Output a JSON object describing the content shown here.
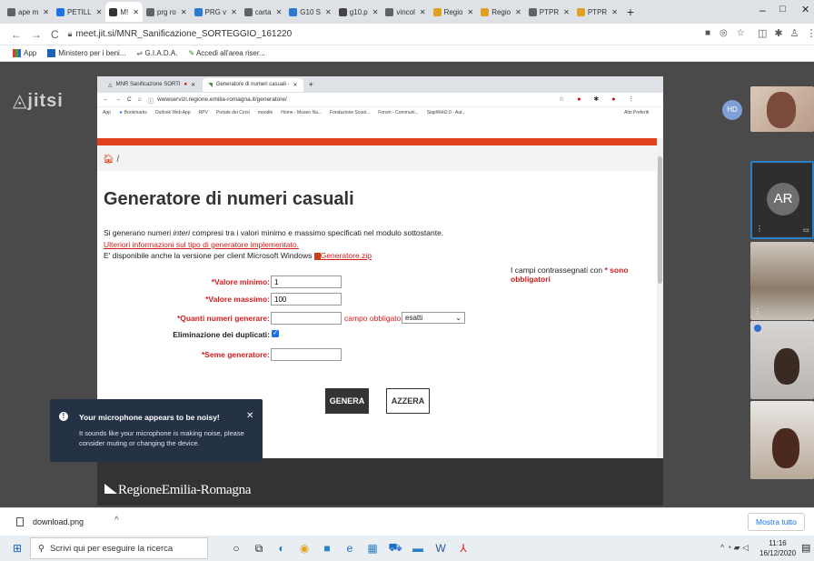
{
  "outer_tabs": [
    {
      "label": "ape m",
      "color": "#5f6368"
    },
    {
      "label": "PETILL",
      "color": "#1a73e8"
    },
    {
      "label": "M!",
      "color": "#333333"
    },
    {
      "label": "prg ro",
      "color": "#5f6368"
    },
    {
      "label": "PRG v",
      "color": "#2b7bd0"
    },
    {
      "label": "carta",
      "color": "#5f6368"
    },
    {
      "label": "G10 S",
      "color": "#2b7bd0"
    },
    {
      "label": "g10.p",
      "color": "#444444"
    },
    {
      "label": "vincol",
      "color": "#5f6368"
    },
    {
      "label": "Regio",
      "color": "#e0a020"
    },
    {
      "label": "Regio",
      "color": "#e0a020"
    },
    {
      "label": "PTPR",
      "color": "#5f6368"
    },
    {
      "label": "PTPR",
      "color": "#e0a020"
    }
  ],
  "address_bar": {
    "url": "meet.jit.si/MNR_Sanificazione_SORTEGGIO_161220"
  },
  "bookmarks": [
    "App",
    "Ministero per i beni...",
    "G.I.A.D.A.",
    "Accedi all'area riser..."
  ],
  "jitsi": {
    "logo": "jitsi"
  },
  "inner_browser": {
    "tabs": [
      "MNR Sanificazione SORTI",
      "Generatore di numeri casuali -"
    ],
    "url": "wwwservizi.regione.emilia-romagna.it/generatore/",
    "bookmarks": [
      "App",
      "Bookmarks",
      "Outlook Web App",
      "RPV",
      "Portale dei Corsi",
      "moodle",
      "Home - Museo Na...",
      "Fondazione Scuol...",
      "Forum - Communi...",
      "SiapWeb2.0 - Aut..."
    ],
    "bookmarks_right": "Altri Preferiti"
  },
  "page": {
    "breadcrumb": "/",
    "title": "Generatore di numeri casuali",
    "intro_pre": "Si generano numeri ",
    "intro_em": "interi",
    "intro_post": " compresi tra i valori minimo e massimo specificati nel modulo sottostante.",
    "info_link": "Ulteriori informazioni sul tipo di generatore implementato.",
    "windows_pre": "E' disponibile anche la versione per client Microsoft Windows",
    "windows_link": "Generatore.zip",
    "required_pre": "I campi contrassegnati con ",
    "required_bold": "* sono obbligatori",
    "form": {
      "min_label": "*Valore minimo:",
      "min_value": "1",
      "max_label": "*Valore massimo:",
      "max_value": "100",
      "qty_label": "*Quanti numeri generare:",
      "qty_value": "",
      "qty_note": "campo obbligatorio",
      "qty_select": "esatti",
      "dup_label": "Eliminazione dei duplicati:",
      "seed_label": "*Seme generatore:",
      "seed_value": ""
    },
    "btn_generate": "GENERA",
    "btn_reset": "AZZERA",
    "footer_logo": "RegioneEmilia-Romagna"
  },
  "participants": [
    {
      "initials": "HD",
      "bg": "#7f9fd6"
    },
    {
      "initials": "AR",
      "bg": "#6e6e6e"
    }
  ],
  "notification": {
    "title": "Your microphone appears to be noisy!",
    "body": "It sounds like your microphone is making noise, please consider muting or changing the device."
  },
  "download": {
    "file": "download.png",
    "show_all": "Mostra tutto"
  },
  "taskbar": {
    "search_placeholder": "Scrivi qui per eseguire la ricerca",
    "time": "11:16",
    "date": "16/12/2020"
  }
}
